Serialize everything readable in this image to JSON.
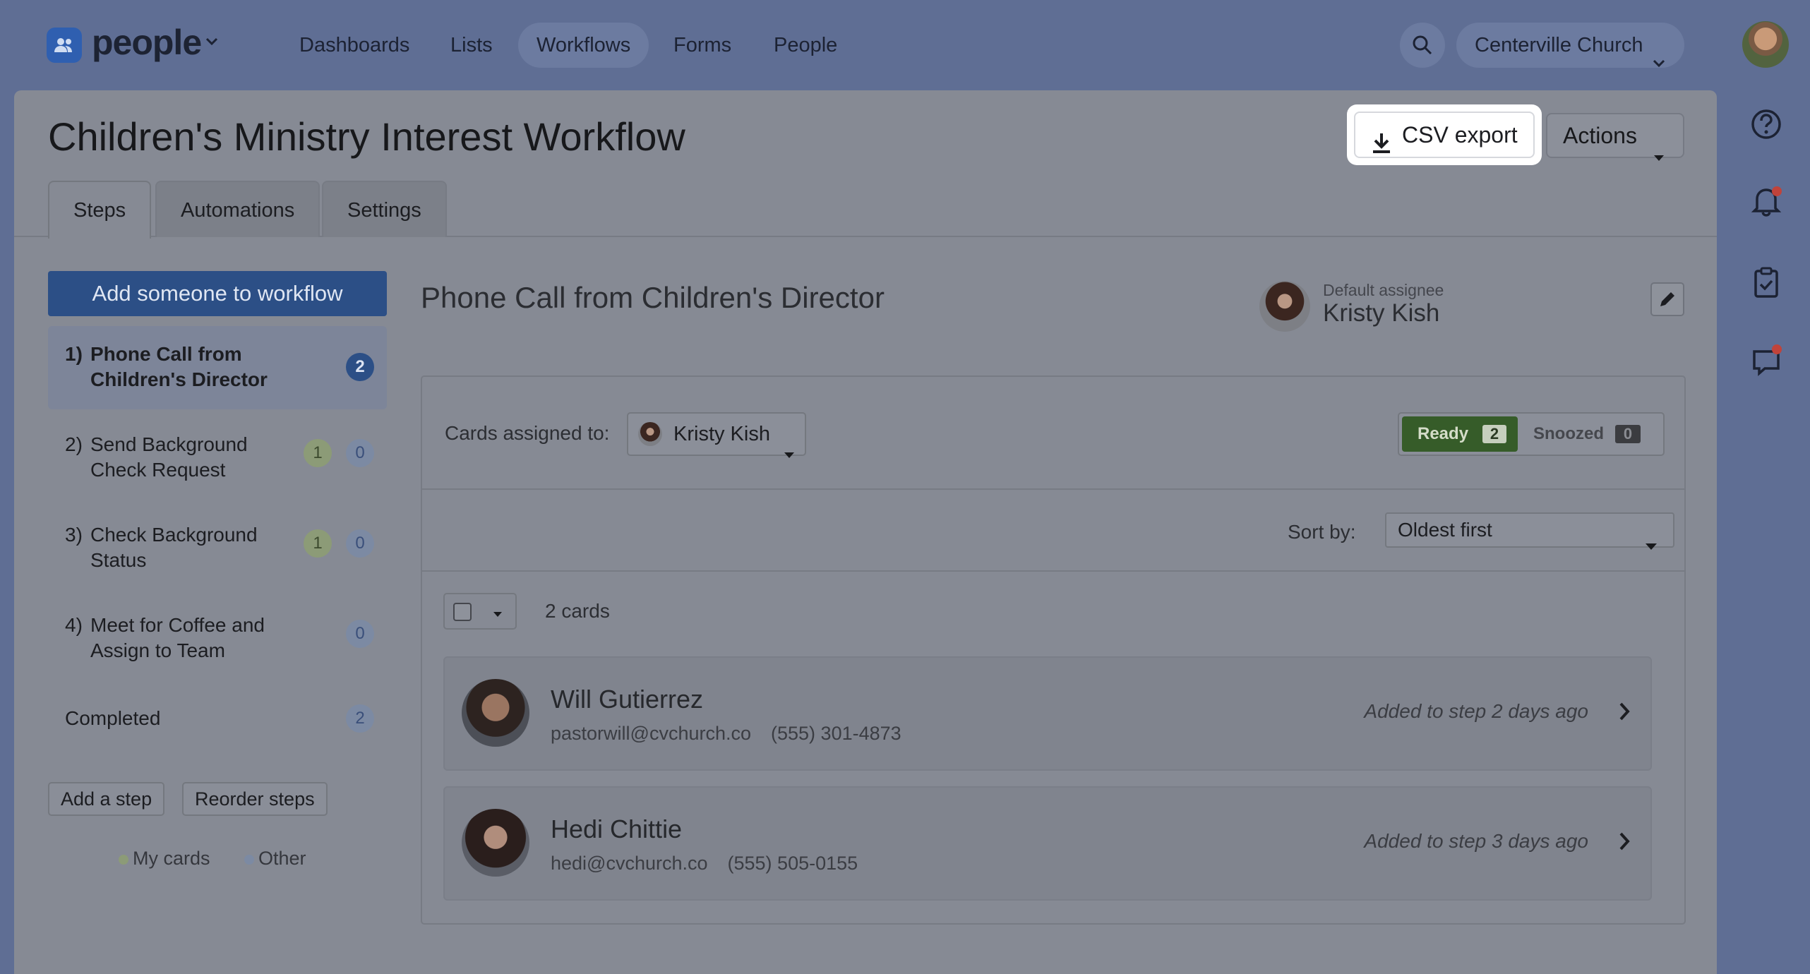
{
  "nav": {
    "brand": "people",
    "items": [
      "Dashboards",
      "Lists",
      "Workflows",
      "Forms",
      "People"
    ],
    "active": "Workflows",
    "org": "Centerville Church"
  },
  "page": {
    "title": "Children's Ministry Interest Workflow",
    "csv_export": "CSV export",
    "actions": "Actions",
    "tabs": [
      "Steps",
      "Automations",
      "Settings"
    ]
  },
  "sidebar": {
    "add_button": "Add someone to workflow",
    "steps": [
      {
        "num": "1)",
        "label": "Phone Call from Children's Director",
        "mine": null,
        "other": "2"
      },
      {
        "num": "2)",
        "label": "Send Background Check Request",
        "mine": "1",
        "other": "0"
      },
      {
        "num": "3)",
        "label": "Check Background Status",
        "mine": "1",
        "other": "0"
      },
      {
        "num": "4)",
        "label": "Meet for Coffee and Assign to Team",
        "mine": null,
        "other": "0"
      }
    ],
    "completed": {
      "label": "Completed",
      "count": "2"
    },
    "add_step": "Add a step",
    "reorder_steps": "Reorder steps",
    "legend_my": "My cards",
    "legend_other": "Other"
  },
  "step_detail": {
    "title": "Phone Call from Children's Director",
    "default_assignee_label": "Default assignee",
    "default_assignee": "Kristy Kish",
    "cards_assigned_label": "Cards assigned to:",
    "cards_assigned_value": "Kristy Kish",
    "ready_label": "Ready",
    "ready_count": "2",
    "snoozed_label": "Snoozed",
    "snoozed_count": "0",
    "sort_label": "Sort by:",
    "sort_value": "Oldest first",
    "card_count": "2 cards",
    "cards": [
      {
        "name": "Will Gutierrez",
        "email": "pastorwill@cvchurch.co",
        "phone": "(555) 301-4873",
        "added": "Added to step 2 days ago"
      },
      {
        "name": "Hedi Chittie",
        "email": "hedi@cvchurch.co",
        "phone": "(555) 505-0155",
        "added": "Added to step 3 days ago"
      }
    ]
  },
  "colors": {
    "primary": "#2c4f86",
    "ready": "#365c29",
    "notification": "#c1433a"
  }
}
